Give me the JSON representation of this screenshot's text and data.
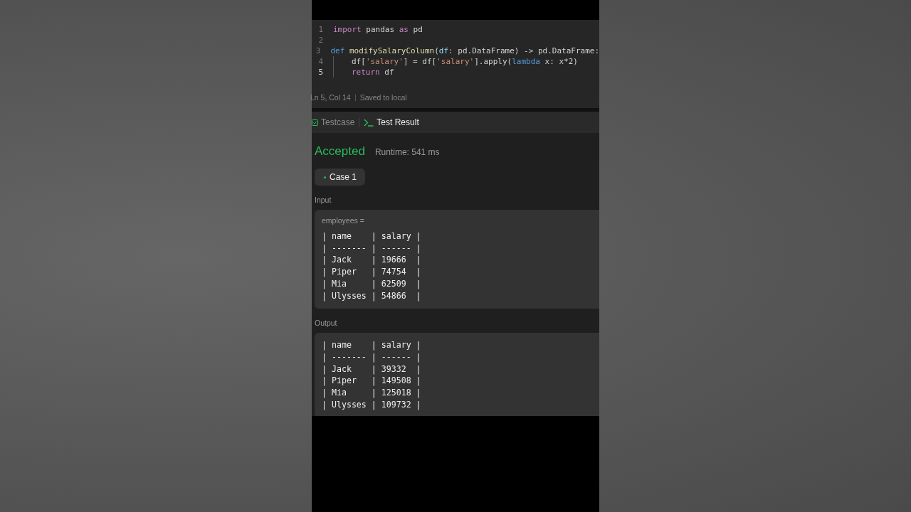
{
  "editor": {
    "lines": [
      {
        "number": "1",
        "active": false,
        "indent": false,
        "tokens": [
          {
            "kind": "keyword",
            "text": "import"
          },
          {
            "kind": "plain",
            "text": " pandas "
          },
          {
            "kind": "keyword",
            "text": "as"
          },
          {
            "kind": "plain",
            "text": " pd"
          }
        ]
      },
      {
        "number": "2",
        "active": false,
        "indent": false
      },
      {
        "number": "3",
        "active": false,
        "indent": false,
        "tokens": [
          {
            "kind": "storage",
            "text": "def"
          },
          {
            "kind": "function",
            "text": " modifySalaryColumn"
          },
          {
            "kind": "plain",
            "text": "("
          },
          {
            "kind": "param",
            "text": "df"
          },
          {
            "kind": "plain",
            "text": ": pd.DataFrame) -> pd.DataFrame:"
          }
        ]
      },
      {
        "number": "4",
        "active": false,
        "indent": true,
        "tokens": [
          {
            "kind": "plain",
            "text": "df["
          },
          {
            "kind": "string",
            "text": "'salary'"
          },
          {
            "kind": "plain",
            "text": "] = df["
          },
          {
            "kind": "string",
            "text": "'salary'"
          },
          {
            "kind": "plain",
            "text": "].apply("
          },
          {
            "kind": "storage",
            "text": "lambda"
          },
          {
            "kind": "plain",
            "text": " x: x*2)"
          }
        ]
      },
      {
        "number": "5",
        "active": true,
        "indent": true,
        "tokens": [
          {
            "kind": "keyword",
            "text": "return"
          },
          {
            "kind": "plain",
            "text": " df"
          }
        ]
      }
    ],
    "status_bar": {
      "position": "Ln 5, Col 14",
      "save_state": "Saved to local"
    }
  },
  "tabs": [
    {
      "label": "Testcase",
      "selected": false
    },
    {
      "label": "Test Result",
      "selected": true
    }
  ],
  "result": {
    "verdict": "Accepted",
    "runtime": "Runtime: 541 ms"
  },
  "cases": [
    {
      "label": "Case 1",
      "selected": true
    }
  ],
  "input": {
    "label": "Input",
    "variable": "employees =",
    "lines": [
      "| name    | salary |",
      "| ------- | ------ |",
      "| Jack    | 19666  |",
      "| Piper   | 74754  |",
      "| Mia     | 62509  |",
      "| Ulysses | 54866  |"
    ]
  },
  "output": {
    "label": "Output",
    "lines": [
      "| name    | salary |",
      "| ------- | ------ |",
      "| Jack    | 39332  |",
      "| Piper   | 149508 |",
      "| Mia     | 125018 |",
      "| Ulysses | 109732 |"
    ]
  }
}
